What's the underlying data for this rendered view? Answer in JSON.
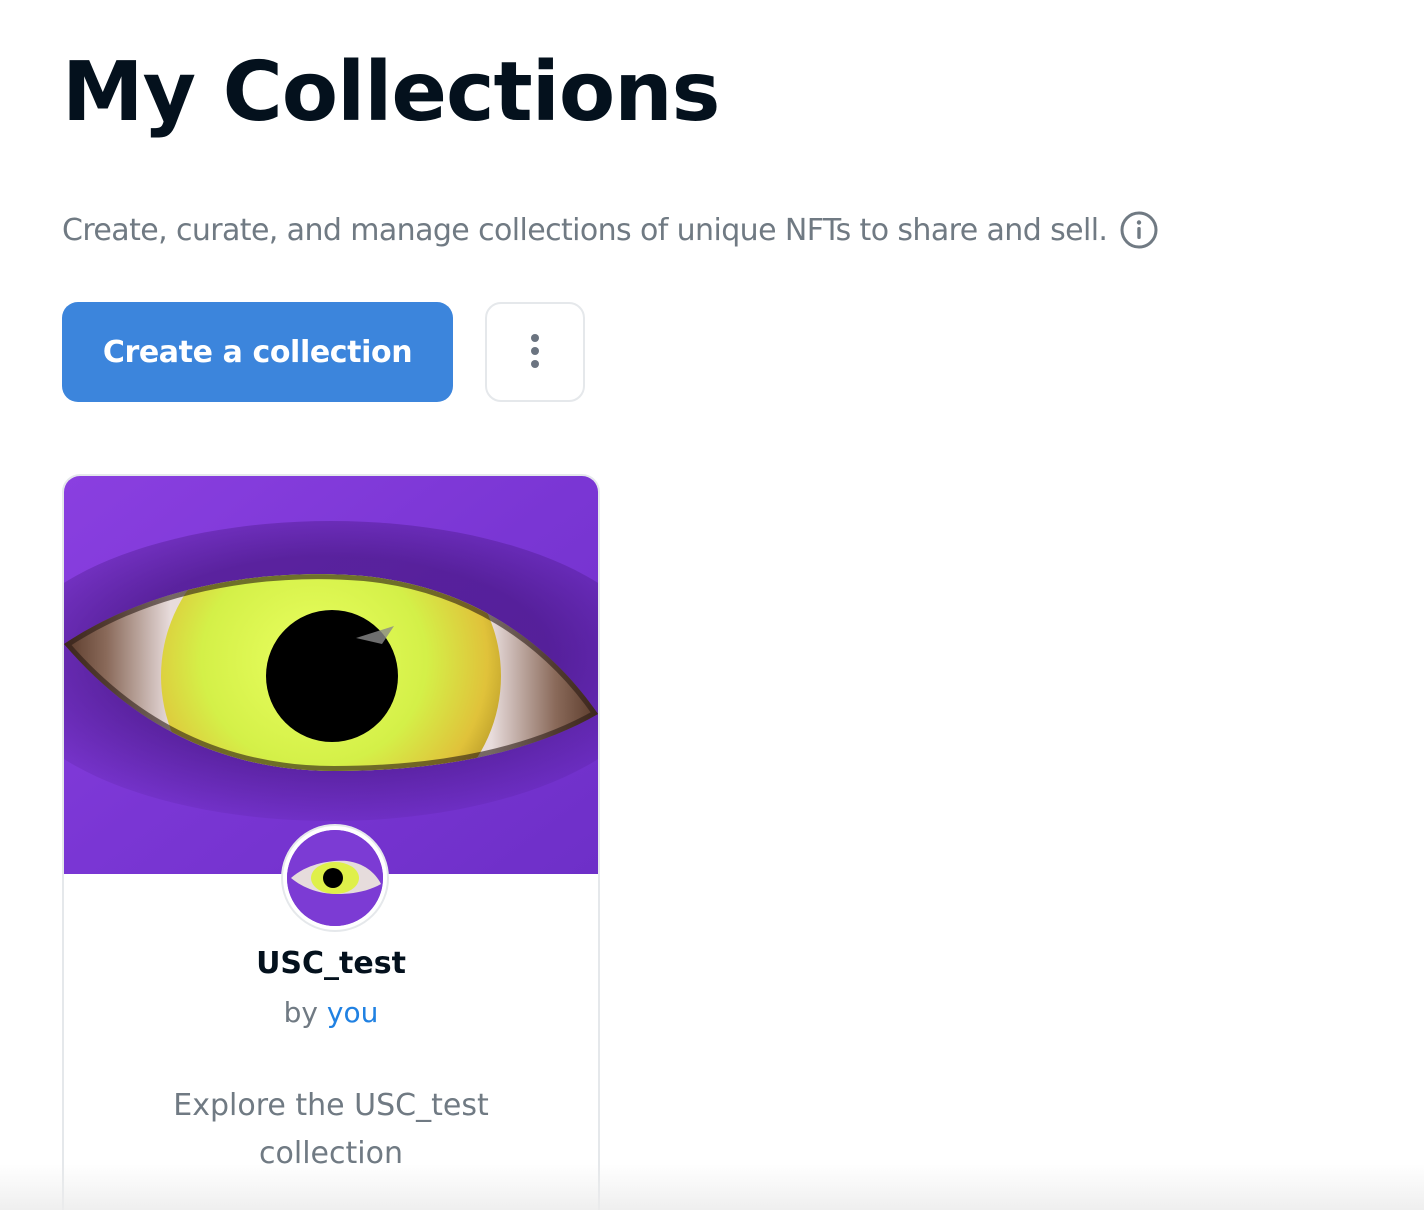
{
  "header": {
    "title": "My Collections",
    "subtitle": "Create, curate, and manage collections of unique NFTs to share and sell."
  },
  "actions": {
    "create_label": "Create a collection",
    "more_icon": "vertical-dots-icon"
  },
  "collections": [
    {
      "name": "USC_test",
      "by_prefix": "by",
      "creator": "you",
      "description": "Explore the USC_test collection",
      "banner_image": "yellow-eye-on-purple",
      "avatar_image": "yellow-eye-on-purple"
    }
  ],
  "colors": {
    "primary_button": "#3c85dc",
    "creator_link": "#2081e2",
    "title_text": "#04111d",
    "muted_text": "#707a83",
    "banner_purple": "#7c3bd4"
  }
}
